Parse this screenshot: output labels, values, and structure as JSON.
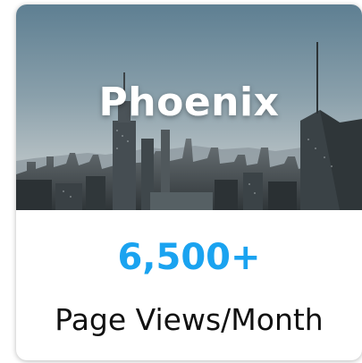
{
  "card": {
    "city_name": "Phoenix",
    "stat_value": "6,500+",
    "stat_label": "Page Views/Month"
  },
  "colors": {
    "accent": "#1aa3f0",
    "label": "#111111"
  },
  "icons": {
    "hero": "city-skyline-photo"
  }
}
